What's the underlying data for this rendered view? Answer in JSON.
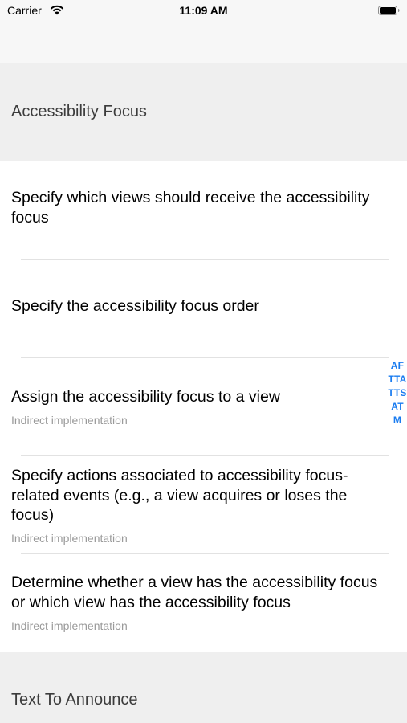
{
  "status_bar": {
    "carrier": "Carrier",
    "time": "11:09 AM"
  },
  "sections": [
    {
      "header": "Accessibility Focus",
      "rows": [
        {
          "title": "Specify which views should receive the accessibility focus",
          "subtitle": ""
        },
        {
          "title": "Specify the accessibility focus order",
          "subtitle": ""
        },
        {
          "title": "Assign the accessibility focus to a view",
          "subtitle": "Indirect implementation"
        },
        {
          "title": "Specify actions associated to accessibility focus-related events (e.g., a view acquires or loses the focus)",
          "subtitle": "Indirect implementation"
        },
        {
          "title": "Determine whether a view has the accessibility focus or which view has the accessibility focus",
          "subtitle": "Indirect implementation"
        }
      ]
    },
    {
      "header": "Text To Announce"
    }
  ],
  "index": [
    "AF",
    "TTA",
    "TTS",
    "AT",
    "M"
  ],
  "colors": {
    "accent": "#1a7cf0",
    "group_background": "#efefef",
    "row_background": "#ffffff",
    "subtitle": "#9a9a9a"
  }
}
